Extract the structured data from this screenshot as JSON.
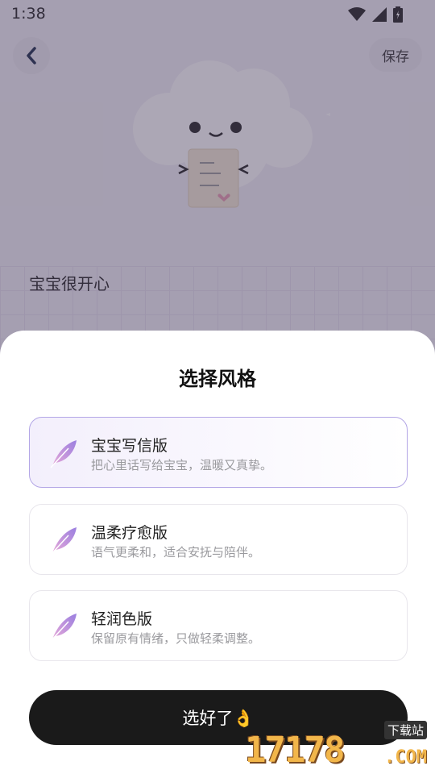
{
  "status": {
    "time": "1:38"
  },
  "header": {
    "save_label": "保存"
  },
  "background": {
    "text": "宝宝很开心"
  },
  "sheet": {
    "title": "选择风格",
    "options": [
      {
        "title": "宝宝写信版",
        "desc": "把心里话写给宝宝，温暖又真挚。",
        "selected": true
      },
      {
        "title": "温柔疗愈版",
        "desc": "语气更柔和，适合安抚与陪伴。",
        "selected": false
      },
      {
        "title": "轻润色版",
        "desc": "保留原有情绪，只做轻柔调整。",
        "selected": false
      }
    ],
    "confirm_label": "选好了👌"
  },
  "watermark": {
    "number": "17178",
    "domain": ".COM",
    "tag": "下载站"
  },
  "colors": {
    "accent": "#b3a6e6",
    "icon": "#b48de0",
    "button": "#1a1a1a"
  },
  "icons": [
    "back-icon",
    "feather-icon",
    "wifi-icon",
    "signal-icon",
    "battery-icon"
  ]
}
